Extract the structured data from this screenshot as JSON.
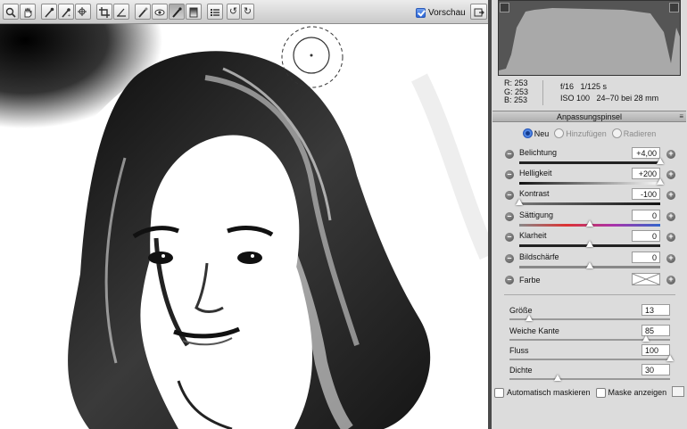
{
  "toolbar": {
    "tools": [
      {
        "name": "zoom-tool",
        "glyph": ""
      },
      {
        "name": "hand-tool",
        "glyph": ""
      },
      {
        "name": "white-balance-tool",
        "glyph": ""
      },
      {
        "name": "color-sampler-tool",
        "glyph": ""
      },
      {
        "name": "targeted-adjustment-tool",
        "glyph": ""
      },
      {
        "name": "crop-tool",
        "glyph": ""
      },
      {
        "name": "straighten-tool",
        "glyph": ""
      },
      {
        "name": "spot-removal-tool",
        "glyph": ""
      },
      {
        "name": "red-eye-tool",
        "glyph": ""
      },
      {
        "name": "adjustment-brush-tool",
        "glyph": ""
      },
      {
        "name": "graduated-filter-tool",
        "glyph": ""
      },
      {
        "name": "preferences-tool",
        "glyph": ""
      },
      {
        "name": "rotate-left-tool",
        "glyph": "↺"
      },
      {
        "name": "rotate-right-tool",
        "glyph": "↻"
      }
    ],
    "preview_label": "Vorschau",
    "preview_checked": true
  },
  "info": {
    "r_label": "R:",
    "r_value": "253",
    "g_label": "G:",
    "g_value": "253",
    "b_label": "B:",
    "b_value": "253",
    "aperture": "f/16",
    "shutter": "1/125 s",
    "iso": "ISO 100",
    "lens": "24–70 bei 28 mm"
  },
  "panel": {
    "title": "Anpassungspinsel",
    "menu_icon": "≡",
    "modes": [
      {
        "label": "Neu",
        "active": true
      },
      {
        "label": "Hinzufügen",
        "active": false
      },
      {
        "label": "Radieren",
        "active": false
      }
    ],
    "sliders": [
      {
        "label": "Belichtung",
        "value": "+4,00",
        "position": 1.0
      },
      {
        "label": "Helligkeit",
        "value": "+200",
        "position": 1.0
      },
      {
        "label": "Kontrast",
        "value": "-100",
        "position": 0.0
      },
      {
        "label": "Sättigung",
        "value": "0",
        "position": 0.5
      },
      {
        "label": "Klarheit",
        "value": "0",
        "position": 0.5
      },
      {
        "label": "Bildschärfe",
        "value": "0",
        "position": 0.5
      }
    ],
    "color_label": "Farbe",
    "brush": [
      {
        "label": "Größe",
        "value": "13",
        "position": 0.12
      },
      {
        "label": "Weiche Kante",
        "value": "85",
        "position": 0.85
      },
      {
        "label": "Fluss",
        "value": "100",
        "position": 1.0
      },
      {
        "label": "Dichte",
        "value": "30",
        "position": 0.3
      }
    ],
    "auto_mask_label": "Automatisch maskieren",
    "show_mask_label": "Maske anzeigen"
  }
}
